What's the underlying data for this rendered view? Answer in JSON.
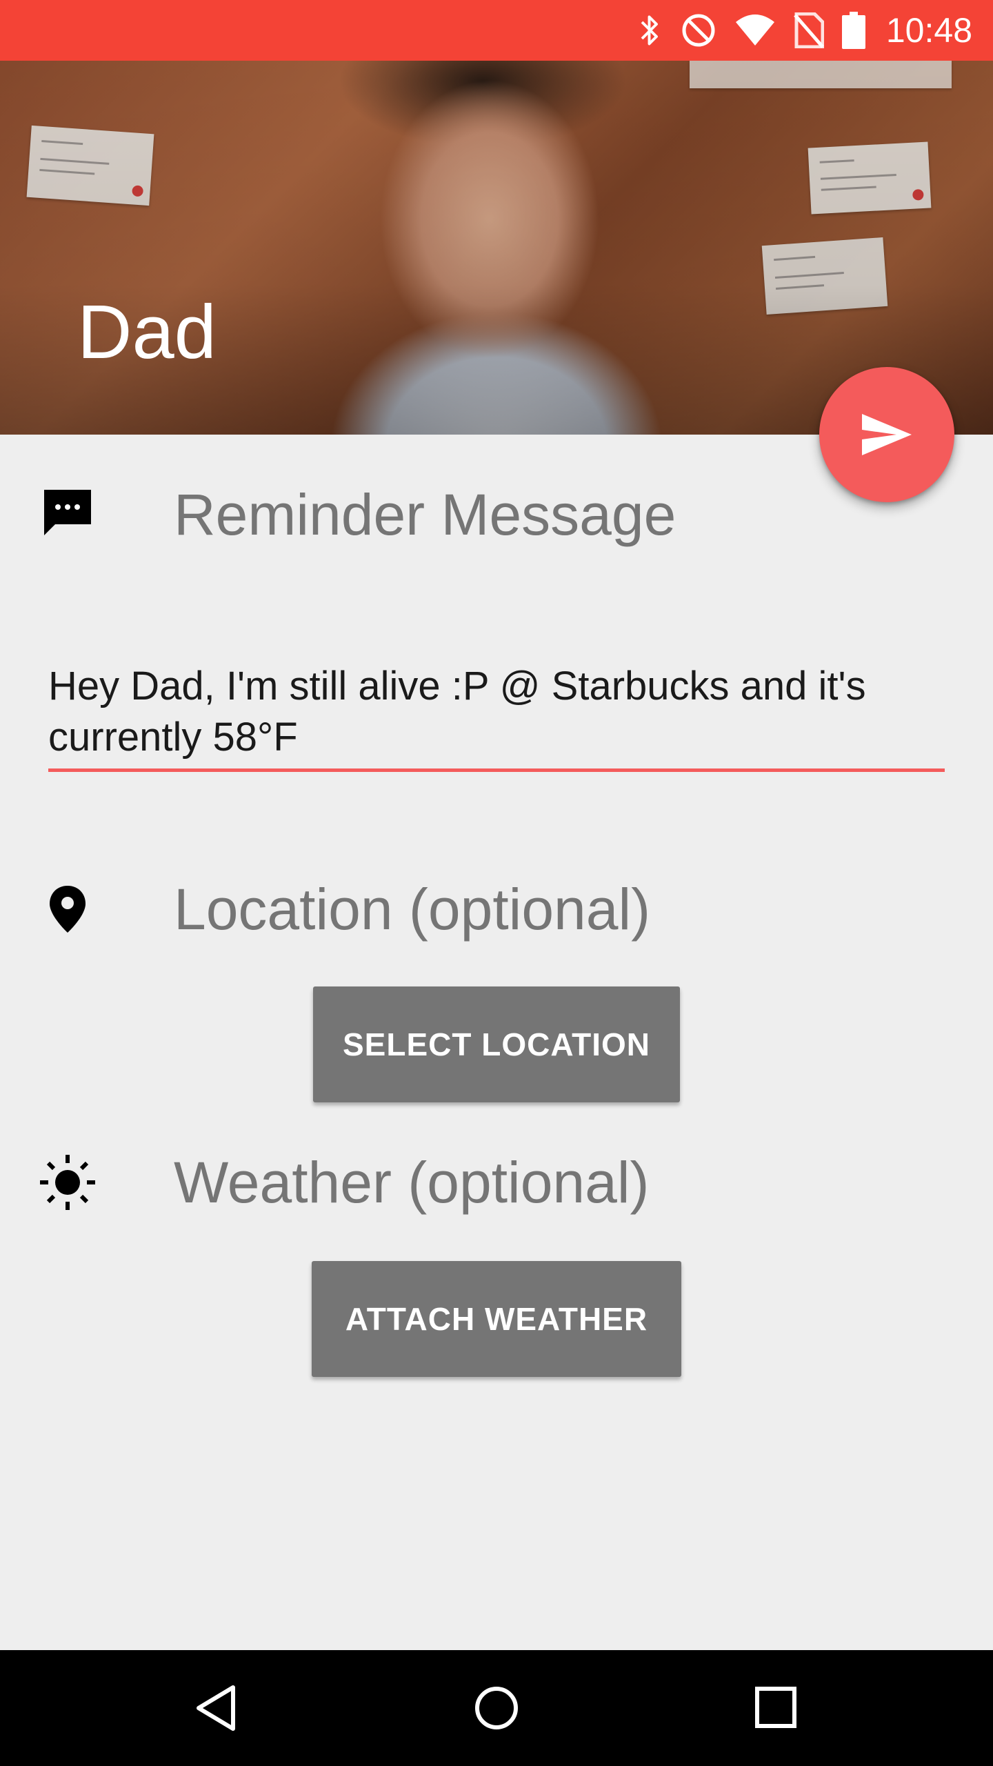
{
  "status_bar": {
    "time": "10:48",
    "icons": [
      "bluetooth-icon",
      "do-not-disturb-icon",
      "wifi-icon",
      "no-sim-icon",
      "battery-icon"
    ],
    "color": "#f44336"
  },
  "header": {
    "contact_name": "Dad"
  },
  "fab": {
    "icon": "send-icon",
    "color": "#f45b5b"
  },
  "reminder": {
    "icon": "message-icon",
    "label": "Reminder Message",
    "value": "Hey Dad, I'm still alive :P @ Starbucks and it's currently 58°F"
  },
  "location": {
    "icon": "location-pin-icon",
    "label": "Location (optional)",
    "button_label": "SELECT LOCATION"
  },
  "weather": {
    "icon": "sun-icon",
    "label": "Weather (optional)",
    "button_label": "ATTACH WEATHER"
  },
  "nav_bar": {
    "buttons": [
      "back-icon",
      "home-icon",
      "recents-icon"
    ]
  }
}
